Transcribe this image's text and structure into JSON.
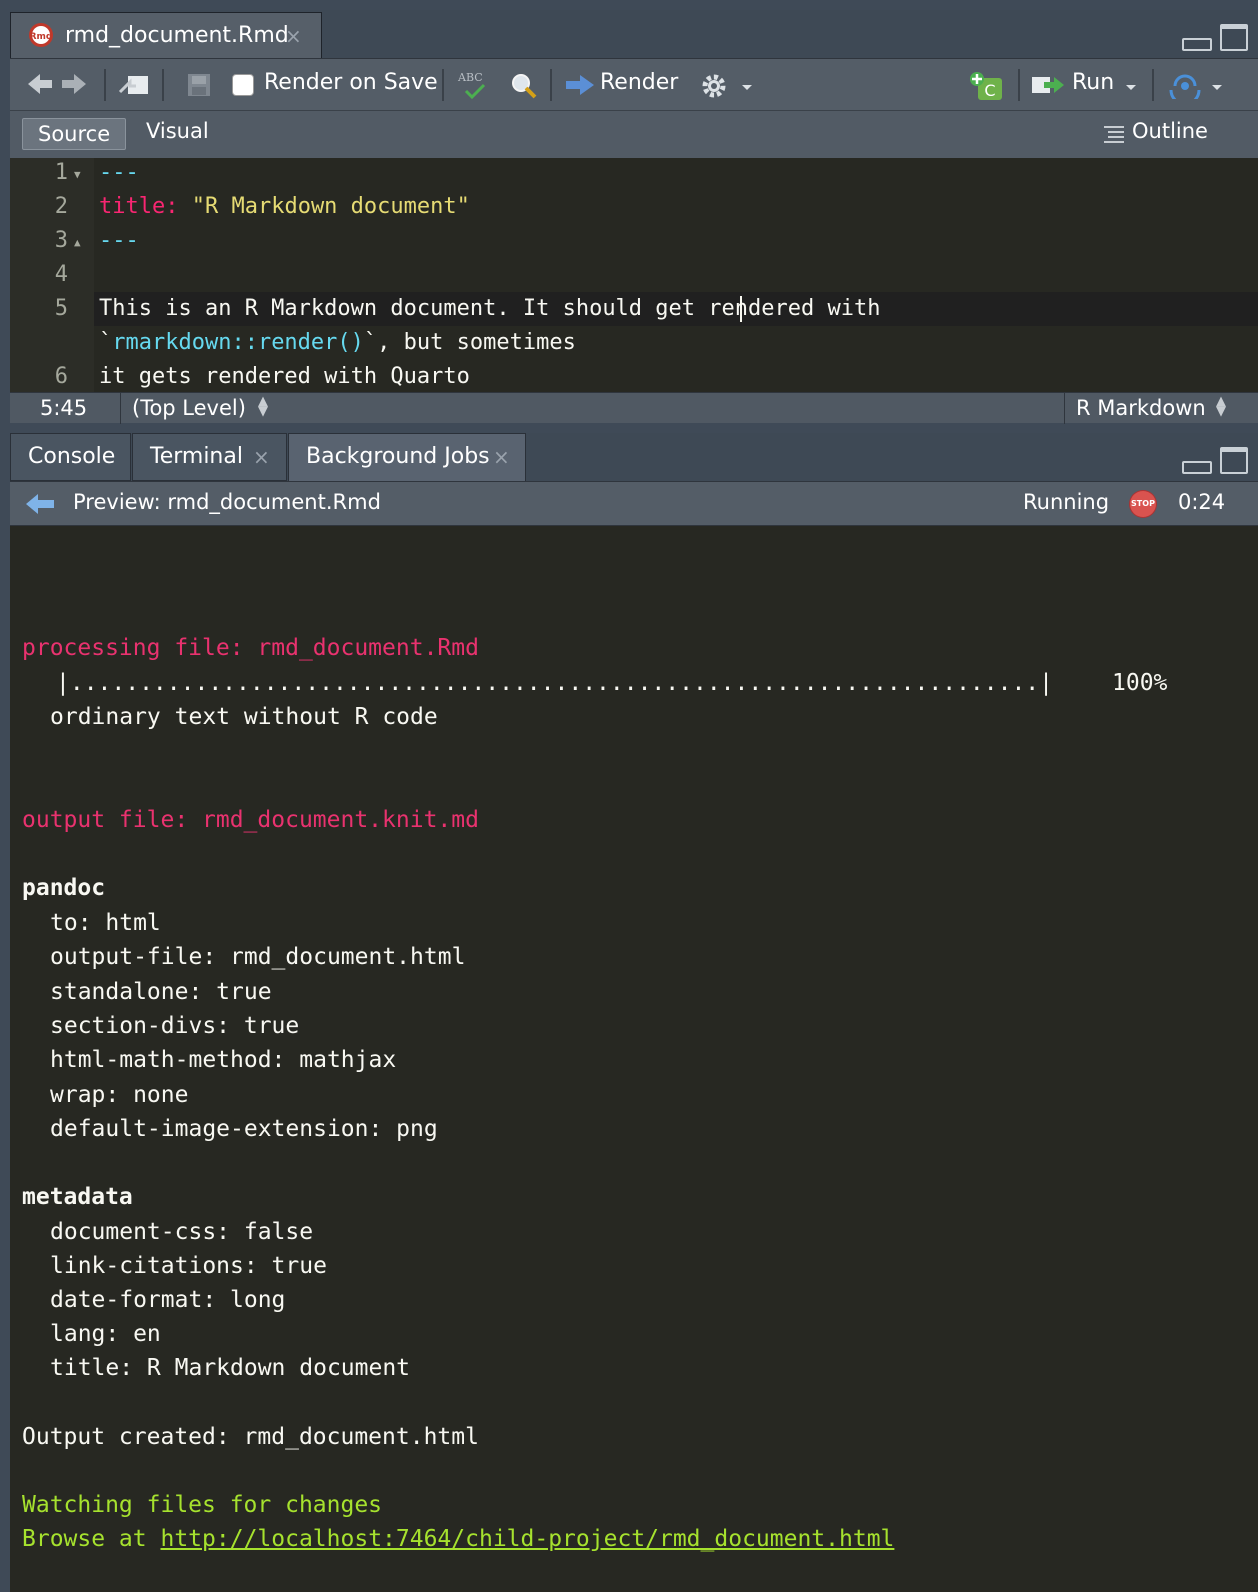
{
  "editor": {
    "tab": {
      "icon": "rmd-file-icon",
      "title": "rmd_document.Rmd",
      "close": "×"
    },
    "toolbar": {
      "render_on_save_label": "Render on Save",
      "spellcheck_label": "ABC",
      "render_label": "Render",
      "run_label": "Run",
      "insert_chunk_label": "C"
    },
    "modes": {
      "source": "Source",
      "visual": "Visual",
      "outline": "Outline"
    },
    "lines": [
      {
        "number": "1",
        "text": "---"
      },
      {
        "number": "2",
        "key": "title:",
        "value": "\"R Markdown document\""
      },
      {
        "number": "3",
        "text": "---"
      },
      {
        "number": "4",
        "text": ""
      },
      {
        "number": "5",
        "text_a": "This is an R Markdown document. It should get rendered with",
        "text_b_tick": "`",
        "text_b_code": "rmarkdown::render()",
        "text_b_tick2": "`",
        "text_b_rest": ", but sometimes"
      },
      {
        "number": "6",
        "text": "it gets rendered with Quarto"
      }
    ],
    "status": {
      "position": "5:45",
      "scope": "(Top Level)",
      "mode": "R Markdown"
    }
  },
  "console": {
    "tabs": [
      {
        "label": "Console"
      },
      {
        "label": "Terminal",
        "close": "×"
      },
      {
        "label": "Background Jobs",
        "close": "×"
      }
    ],
    "job": {
      "title": "Preview: rmd_document.Rmd",
      "status": "Running",
      "stop_label": "STOP",
      "elapsed": "0:24"
    },
    "output": {
      "processing": "processing file: rmd_document.Rmd",
      "progress_bar": "|......................................................................|",
      "progress_pct": "100%",
      "progress_value": 1.0,
      "ordinary": "ordinary text without R code",
      "output_file": "output file: rmd_document.knit.md",
      "pandoc_header": "pandoc",
      "pandoc_items": [
        "to: html",
        "output-file: rmd_document.html",
        "standalone: true",
        "section-divs: true",
        "html-math-method: mathjax",
        "wrap: none",
        "default-image-extension: png"
      ],
      "metadata_header": "metadata",
      "metadata_items": [
        "document-css: false",
        "link-citations: true",
        "date-format: long",
        "lang: en",
        "title: R Markdown document"
      ],
      "created": "Output created: rmd_document.html",
      "watching": "Watching files for changes",
      "browse_prefix": "Browse at ",
      "browse_url": "http://localhost:7464/child-project/rmd_document.html"
    }
  },
  "colors": {
    "editor_bg": "#272822",
    "chrome": "#545d67",
    "red_output": "#e9326f",
    "green_output": "#a6e22e"
  }
}
